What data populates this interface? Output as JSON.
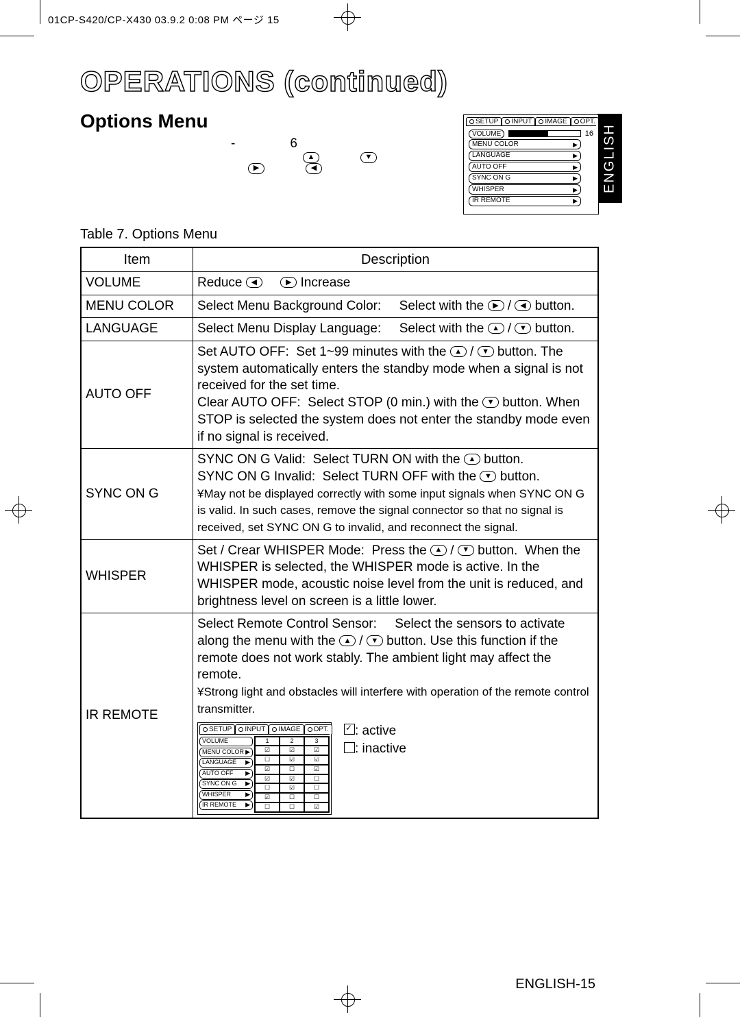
{
  "header_strip": "01CP-S420/CP-X430  03.9.2 0:08 PM  ページ 15",
  "main_title": "OPERATIONS (continued)",
  "section_title": "Options Menu",
  "intro_gap_dash": "-",
  "intro_gap_num": "6",
  "table_caption": "Table 7. Options Menu",
  "th_item": "Item",
  "th_desc": "Description",
  "rows": {
    "volume_item": "VOLUME",
    "volume_desc_a": "Reduce",
    "volume_desc_b": "Increase",
    "menucolor_item": "MENU COLOR",
    "menucolor_desc_a": "Select Menu Background Color:",
    "menucolor_desc_b": "Select with the",
    "menucolor_desc_c": " button.",
    "language_item": "LANGUAGE",
    "language_desc_a": "Select Menu Display Language:",
    "language_desc_b": "Select with the",
    "language_desc_c": " button.",
    "autooff_item": "AUTO OFF",
    "autooff_desc": "Set AUTO OFF:  Set 1~99 minutes with the ⬆ / ⬇ button. The system automatically enters the standby mode when a signal is not received for the set time.\nClear AUTO OFF:  Select STOP (0 min.) with the ⬇ button. When STOP is selected the system does not enter the standby mode even if no signal is received.",
    "sync_item": "SYNC ON G",
    "sync_l1": "SYNC ON G Valid:  Select TURN ON with the ⬆ button.",
    "sync_l2": "SYNC ON G Invalid:  Select TURN OFF with the ⬇ button.",
    "sync_note": "May not be displayed correctly with some input signals when SYNC ON G is valid. In such cases, remove the signal connector so that no signal is received, set SYNC ON G to invalid, and reconnect the signal.",
    "whisper_item": "WHISPER",
    "whisper_desc": "Set / Crear WHISPER Mode:  Press the ⬆ / ⬇ button.  When the WHISPER is selected, the WHISPER mode is active. In the WHISPER mode, acoustic noise level from the unit is reduced, and brightness level on screen is a little lower.",
    "ir_item": "IR REMOTE",
    "ir_desc_a": "Select Remote Control Sensor:     Select the sensors to activate along the menu with the ⬆ / ⬇ button. Use this function if the remote does not work stably. The ambient light may affect the remote.",
    "ir_note": "Strong light and obstacles will interfere with operation of the remote control transmitter.",
    "ir_legend_active": ": active",
    "ir_legend_inactive": ": inactive"
  },
  "osd": {
    "tabs": [
      "SETUP",
      "INPUT",
      "IMAGE",
      "OPT."
    ],
    "volume_label": "VOLUME",
    "volume_value": "16",
    "items": [
      "MENU COLOR",
      "LANGUAGE",
      "AUTO OFF",
      "SYNC ON G",
      "WHISPER",
      "IR REMOTE"
    ]
  },
  "side_tab": "ENGLISH",
  "footer": "ENGLISH-15"
}
